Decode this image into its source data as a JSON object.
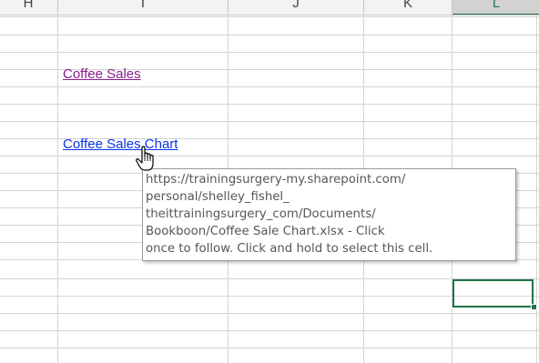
{
  "columns": [
    {
      "label": "H",
      "selected": false
    },
    {
      "label": "I",
      "selected": false
    },
    {
      "label": "J",
      "selected": false
    },
    {
      "label": "K",
      "selected": false
    },
    {
      "label": "L",
      "selected": true
    }
  ],
  "cells": {
    "coffee_sales_link": "Coffee Sales",
    "coffee_sales_chart_link": "Coffee Sales Chart"
  },
  "tooltip": {
    "text": "https://trainingsurgery-my.sharepoint.com/\npersonal/shelley_fishel_\ntheittrainingsurgery_com/Documents/\nBookboon/Coffee Sale Chart.xlsx - Click\nonce to follow. Click and hold to select this cell."
  },
  "colors": {
    "visited_link": "#8b1b8b",
    "link": "#0b32e6",
    "selection_accent": "#217346",
    "gridline": "#d4d4d4"
  },
  "cursor": "hand-pointer-icon"
}
